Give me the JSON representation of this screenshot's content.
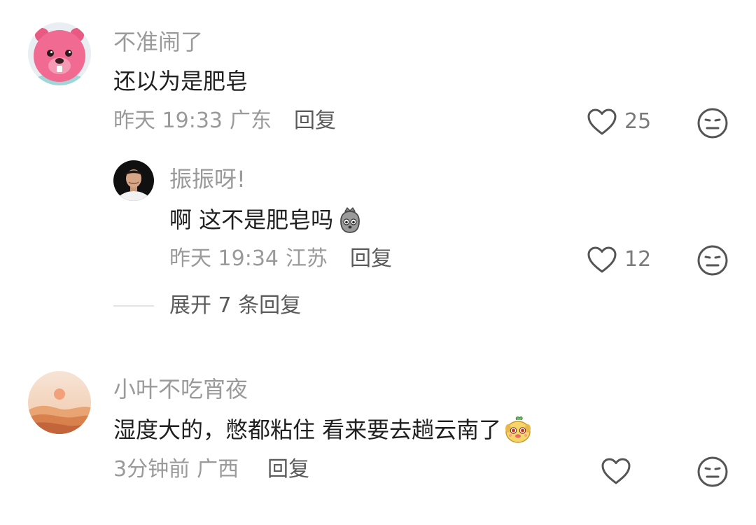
{
  "comments": [
    {
      "username": "不准闹了",
      "text": "还以为是肥皂",
      "time": "昨天 19:33",
      "location": "广东",
      "reply_label": "回复",
      "likes": "25",
      "replies": [
        {
          "username": "振振呀!",
          "text": "啊 这不是肥皂吗",
          "emoji": "sack-face-emoji",
          "time": "昨天 19:34",
          "location": "江苏",
          "reply_label": "回复",
          "likes": "12"
        }
      ],
      "expand_label": "展开 7 条回复"
    },
    {
      "username": "小叶不吃宵夜",
      "text": "湿度大的，憋都粘住 看来要去趟云南了",
      "emoji": "cute-dog-emoji",
      "time": "3分钟前",
      "location": "广西",
      "reply_label": "回复",
      "likes": ""
    }
  ],
  "colors": {
    "username": "#9a9a9a",
    "body_text": "#1f1f1f",
    "meta": "#9a9a9a",
    "icon_stroke": "#555555",
    "avatar1_pink": "#f06a92"
  }
}
